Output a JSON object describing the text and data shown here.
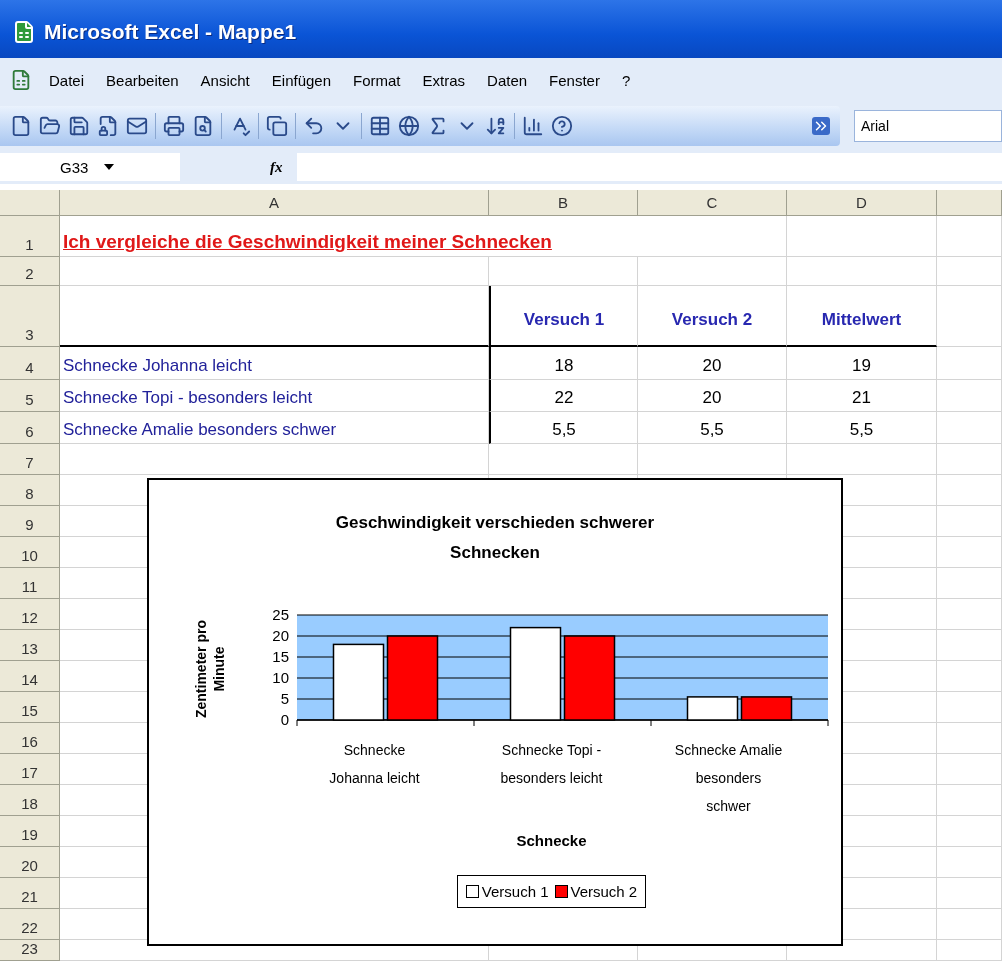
{
  "window": {
    "title": "Microsoft Excel - Mappe1"
  },
  "menu": [
    "Datei",
    "Bearbeiten",
    "Ansicht",
    "Einfügen",
    "Format",
    "Extras",
    "Daten",
    "Fenster",
    "?"
  ],
  "toolbar": {
    "font": "Arial"
  },
  "formula_bar": {
    "name_box": "G33",
    "fx": "fx"
  },
  "sheet": {
    "columns": [
      "A",
      "B",
      "C",
      "D"
    ],
    "row_numbers": [
      "1",
      "2",
      "3",
      "4",
      "5",
      "6",
      "7",
      "8",
      "9",
      "10",
      "11",
      "12",
      "13",
      "14",
      "15",
      "16",
      "17",
      "18",
      "19",
      "20",
      "21",
      "22",
      "23"
    ],
    "title": "Ich vergleiche die Geschwindigkeit meiner Schnecken",
    "header": [
      "Versuch 1",
      "Versuch 2",
      "Mittelwert"
    ],
    "data": [
      {
        "name": "Schnecke Johanna leicht",
        "values": [
          "18",
          "20",
          "19"
        ]
      },
      {
        "name": "Schnecke Topi - besonders leicht",
        "values": [
          "22",
          "20",
          "21"
        ]
      },
      {
        "name": "Schnecke Amalie besonders schwer",
        "values": [
          "5,5",
          "5,5",
          "5,5"
        ]
      }
    ]
  },
  "chart": {
    "chart_data": {
      "type": "bar",
      "title": "Geschwindigkeit verschieden schwerer Schnecken",
      "xlabel": "Schnecke",
      "ylabel": "Zentimeter pro Minute",
      "categories": [
        "Schnecke Johanna leicht",
        "Schnecke Topi - besonders leicht",
        "Schnecke Amalie besonders schwer"
      ],
      "series": [
        {
          "name": "Versuch 1",
          "color": "#ffffff",
          "values": [
            18,
            22,
            5.5
          ]
        },
        {
          "name": "Versuch 2",
          "color": "#ff0000",
          "values": [
            20,
            20,
            5.5
          ]
        }
      ],
      "ylim": [
        0,
        25
      ],
      "yticks": [
        0,
        5,
        10,
        15,
        20,
        25
      ],
      "grid": true,
      "legend": true
    }
  }
}
